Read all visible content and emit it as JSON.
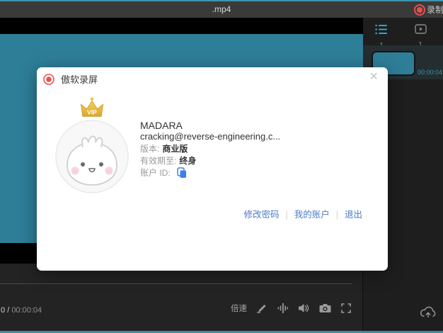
{
  "titlebar": {
    "filename": ".mp4",
    "record_label": "录制"
  },
  "right_panel": {
    "clip_list_count": "1",
    "video_count": "1",
    "clip_duration": "00:00:04"
  },
  "bottom_bar": {
    "time_current": "0",
    "time_separator": "/",
    "time_total": "00:00:04",
    "speed_label": "倍速"
  },
  "dialog": {
    "app_name": "傲软录屏",
    "close_label": "×",
    "vip_label": "VIP",
    "username": "MADARA",
    "email": "cracking@reverse-engineering.c...",
    "version_label": "版本:",
    "version_value": "商业版",
    "expiry_label": "有效期至:",
    "expiry_value": "终身",
    "account_id_label": "账户 ID:",
    "links": {
      "change_password": "修改密码",
      "my_account": "我的账户",
      "logout": "退出",
      "separator": "|"
    }
  },
  "colors": {
    "video_teal": "#2e7e98",
    "accent_teal": "#2fa8c5",
    "record_red": "#e8504f",
    "link_blue": "#4a7bc8"
  }
}
